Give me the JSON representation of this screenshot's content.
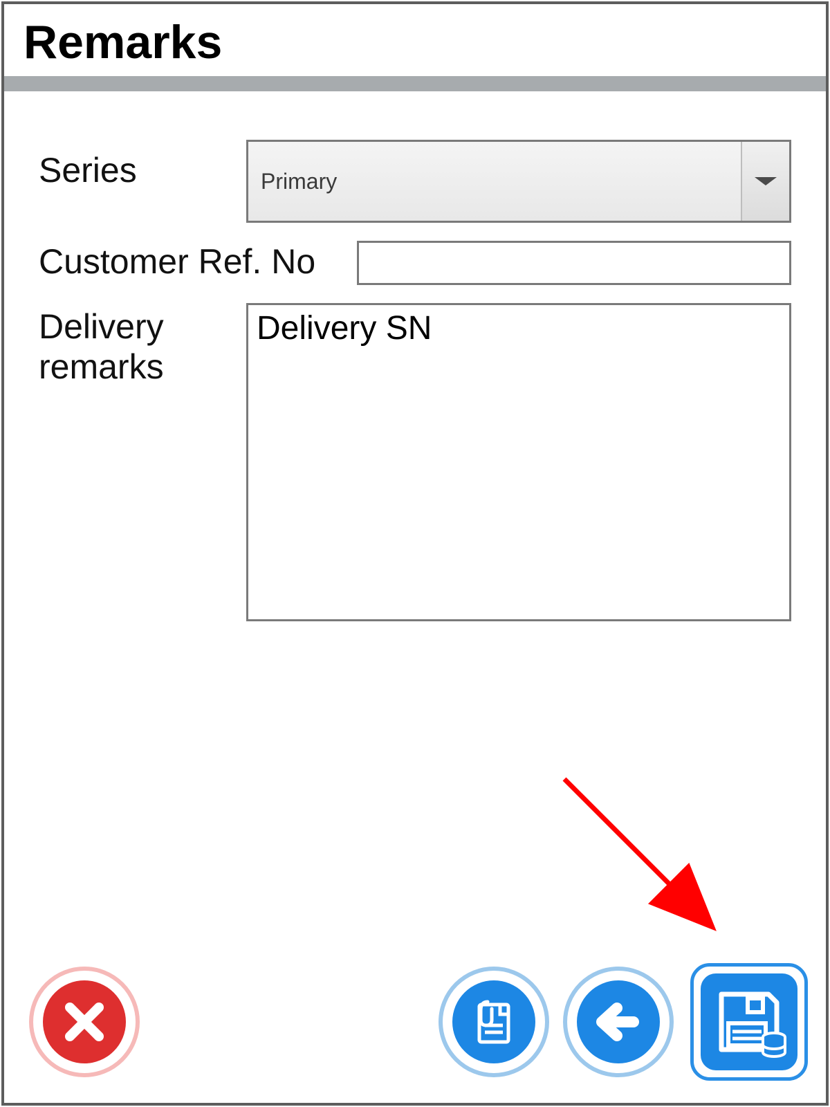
{
  "title": "Remarks",
  "form": {
    "series": {
      "label": "Series",
      "value": "Primary"
    },
    "customer_ref": {
      "label": "Customer Ref. No",
      "value": ""
    },
    "delivery_remarks": {
      "label": "Delivery remarks",
      "value": "Delivery SN"
    }
  },
  "buttons": {
    "cancel_icon": "close-icon",
    "attach_icon": "paperclip-document-icon",
    "back_icon": "arrow-left-icon",
    "save_icon": "save-to-database-icon"
  },
  "colors": {
    "accent_blue": "#1d87e4",
    "danger_red": "#de2f2f",
    "divider_grey": "#a7abae",
    "annotation_red": "#ff0000"
  }
}
